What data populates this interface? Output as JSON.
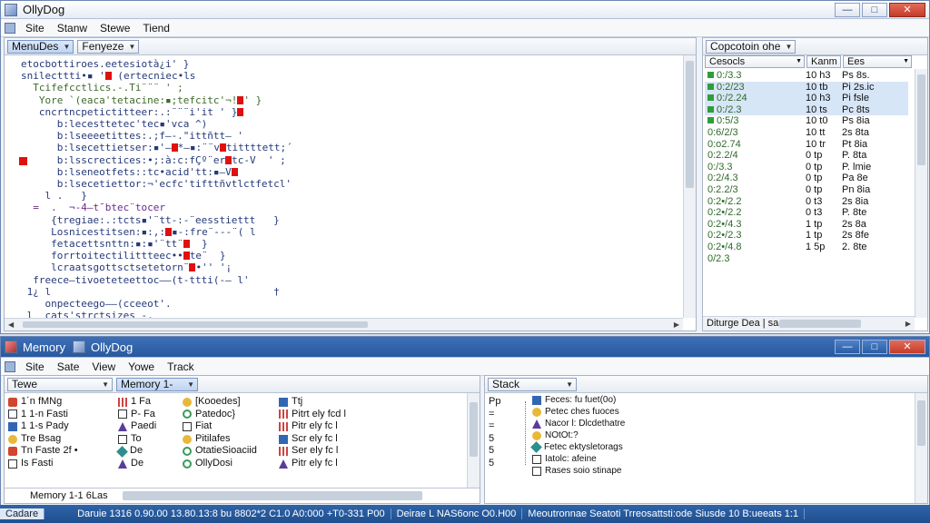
{
  "window_main": {
    "title": "OllyDog",
    "btn_min": "—",
    "btn_max": "□",
    "btn_close": "✕"
  },
  "menu_main": [
    "Site",
    "Stanw",
    "Stewe",
    "Tiend"
  ],
  "code_pane": {
    "dropdown1": "MenuDes",
    "dropdown2": "Fenyeze",
    "lines": [
      "etocbottiroes.eetesiotà¿i' }",
      "snilecttti•▪ ' (ertecniec•ls",
      "  Tcifefcctlics.-.Ti¨¨¨ ' ;",
      "   Yore `(eaca'tetacine:▪;tefcitc'¬!' }",
      "   cncrtncpetictitteer:.:¨¨¨i'it ' }",
      "      b:lecesttetec'tec▪'vca ^)",
      "      b:lseeeetittes:.;f–-.\"ittñtt– '",
      "      b:lsecettietser:▪'–*–▪:¨¨vtittttett;´",
      "      b:lsscrectices:•;:à:c:fÇº¨ertc-V  ' ;",
      "      b:lseneotfets::tc•acid'tt:▪–V",
      "      b:lsecetiettor:¬'ecfc'tifttñvtlctfetcl'",
      "    l .   }",
      "  =  .  ¬-4–t¯btec¨tocer",
      "     {tregiae:.:tcts▪'¨tt-:-¨eesstiettt   }",
      "     Losnicestitsen:▪:,:▪-:fre¨---¨( l",
      "     fetacettsnttn:▪:▪'¨tt¨  }",
      "     forrtoitectilittteec••te¨  }",
      "     lcraatsgottsctsetetorn¨•'' '¡",
      "  freece–tivoeteteettoc––(t-ttti(-– l'",
      " 1¿ l                                     †",
      "    onpecteego––(cceeot'.",
      " l  cats'strctsizes -."
    ]
  },
  "reg_pane": {
    "dropdown": "Copcotoin ohe",
    "col1": "Cesocls",
    "col2": "Kanm",
    "col3": "Ees",
    "rows": [
      {
        "a": "0:/3.3",
        "b": "10 h3",
        "c": "Ps 8s."
      },
      {
        "a": "0:2/23",
        "b": "10 tb",
        "c": "Pi 2s.ic"
      },
      {
        "a": "0:/2.24",
        "b": "10 h3",
        "c": "Pi fsle"
      },
      {
        "a": "0:/2.3",
        "b": "10 ts",
        "c": "Pc 8ts"
      },
      {
        "a": "0:5/3",
        "b": "10 t0",
        "c": "Ps 8ia"
      },
      {
        "a": "0:6/2/3",
        "b": "10 tt",
        "c": "2s 8ta"
      },
      {
        "a": "0:o2.74",
        "b": "10 tr",
        "c": "Pt 8ia"
      },
      {
        "a": "0:2.2/4",
        "b": "0 tp",
        "c": "P. 8ta"
      },
      {
        "a": "0:/3.3",
        "b": "0 tp",
        "c": "P. lmie"
      },
      {
        "a": "0:2/4.3",
        "b": "0 tp",
        "c": "Pa 8e"
      },
      {
        "a": "0:2.2/3",
        "b": "0 tp",
        "c": "Pn 8ia"
      },
      {
        "a": "0:2•/2.2",
        "b": "0 t3",
        "c": "2s 8ia"
      },
      {
        "a": "0:2•/2.2",
        "b": "0 t3",
        "c": "P. 8te"
      },
      {
        "a": "0:2•/4.3",
        "b": "1 tp",
        "c": "2s 8a"
      },
      {
        "a": "0:2•/2.3",
        "b": "1 tp",
        "c": "2s 8fe"
      },
      {
        "a": "0:2•/4.8",
        "b": "1 5p",
        "c": "2. 8te"
      },
      {
        "a": "0/2.3",
        "b": "",
        "c": ""
      }
    ],
    "footer": "Diturge Dea | saa"
  },
  "window_mem": {
    "title1": "Memory",
    "title2": "OllyDog"
  },
  "menu_mem": [
    "Site",
    "Sate",
    "View",
    "Yowe",
    "Track"
  ],
  "mem_pane": {
    "dropdown1": "Tewe",
    "dropdown2": "Memory 1-",
    "col1": [
      {
        "t": "1´n  fMNg",
        "ic": "red"
      },
      {
        "t": "1  1-n  Fasti",
        "ic": "box"
      },
      {
        "t": "1  1-s  Pady",
        "ic": "blu"
      },
      {
        "t": "Tre Bsag",
        "ic": "yel"
      },
      {
        "t": "Tn Faste  2f •",
        "ic": "red"
      },
      {
        "t": "Is  Fasti",
        "ic": "box"
      }
    ],
    "col2": [
      {
        "t": "1   Fa",
        "ic": "bars"
      },
      {
        "t": "P-   Fa",
        "ic": "box"
      },
      {
        "t": "Paedi",
        "ic": "tri"
      },
      {
        "t": "To",
        "ic": "box"
      },
      {
        "t": "De",
        "ic": "dia"
      },
      {
        "t": "De",
        "ic": "tri"
      }
    ],
    "col3": [
      {
        "t": "[Kooedes]",
        "ic": "yel"
      },
      {
        "t": "Patedoc}",
        "ic": "ring"
      },
      {
        "t": "Fiat",
        "ic": "box"
      },
      {
        "t": "Pitilafes",
        "ic": "yel"
      },
      {
        "t": "OtatieSioaciid",
        "ic": "ring"
      },
      {
        "t": "OllyDosi",
        "ic": "ring"
      }
    ],
    "col4": [
      {
        "t": "Ttj",
        "ic": "blu"
      },
      {
        "t": "Pitrt ely  fcd   l",
        "ic": "bars"
      },
      {
        "t": "Pitr ely  fc  l",
        "ic": "bars"
      },
      {
        "t": "Scr ely  fc  l",
        "ic": "blu"
      },
      {
        "t": "Ser ely  fc  l",
        "ic": "bars"
      },
      {
        "t": "Pitr ely  fc  l",
        "ic": "tri"
      }
    ],
    "footer": "Memory 1-1 6Las"
  },
  "stack_pane": {
    "dropdown": "Stack",
    "left": [
      "Pp",
      "=",
      "=",
      "5",
      "5",
      "5"
    ],
    "rows": [
      "Feces: fu fuet(0o)",
      "Petec ches fuoces",
      "Nacor l: Dlcdethatre",
      "NOtOt:?",
      "Fetec ektysletorags",
      "Iatolc: afeine",
      "Rases soio stinape"
    ]
  },
  "statusbar": [
    "Cadare",
    "Daruie 1316  0.90.00 13.80.13:8 bu 8802*2 C1.0 A0:000 +T0-331 P00",
    "Deirae L  NAS6onc O0.H00",
    "Meoutronnae Seatoti Trreosattsti:ode Siusde 10 B:ueeats 1:1"
  ]
}
